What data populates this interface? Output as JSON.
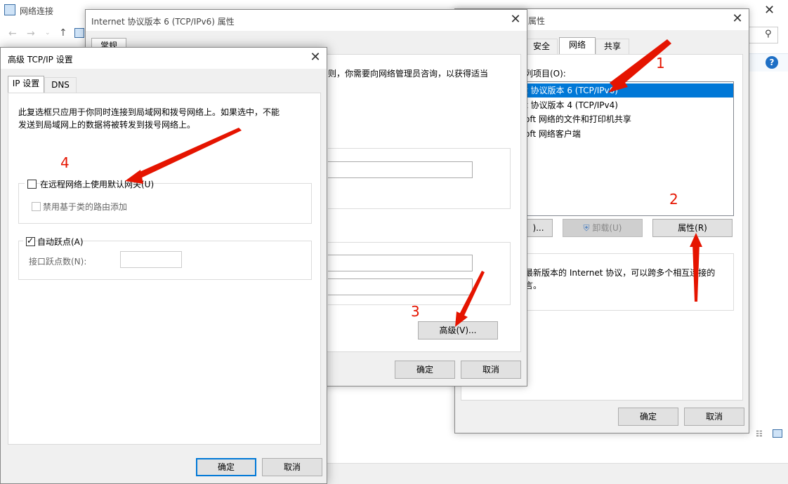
{
  "explorer": {
    "title": "网络连接",
    "taskbar_hint": "⬚"
  },
  "props_dialog": {
    "title": "属性",
    "tabs": [
      "安全",
      "网络",
      "共享"
    ],
    "items_label": "此连接使用下列项目(O):",
    "items_label_visible": "列项目(O):",
    "items": [
      "Internet 协议版本 6 (TCP/IPv6)",
      "Internet 协议版本 4 (TCP/IPv4)",
      "Microsoft 网络的文件和打印机共享",
      "Microsoft 网络客户端"
    ],
    "items_visible": [
      "t 协议版本 6 (TCP/IPv6)",
      "t 协议版本 4 (TCP/IPv4)",
      "oft 网络的文件和打印机共享",
      "oft 网络客户端"
    ],
    "install_btn": ")...",
    "uninstall_btn": "卸载(U)",
    "properties_btn": "属性(R)",
    "desc_line1": "最新版本的 Internet 协议，可以跨多个相互连接的",
    "desc_line2": "言。",
    "ok": "确定",
    "cancel": "取消"
  },
  "ipv6_dialog": {
    "title": "Internet 协议版本 6 (TCP/IPv6) 属性",
    "tab": "常规",
    "text": "则，你需要向网络管理员咨询，以获得适当",
    "advanced_btn": "高级(V)...",
    "ok": "确定",
    "cancel": "取消"
  },
  "adv_dialog": {
    "title": "高级 TCP/IP 设置",
    "tabs": [
      "IP 设置",
      "DNS"
    ],
    "desc_line1": "此复选框只应用于你同时连接到局域网和拨号网络上。如果选中，不能",
    "desc_line2": "发送到局域网上的数据将被转发到拨号网络上。",
    "use_default_gateway": "在远程网络上使用默认网关(U)",
    "disable_class_route": "禁用基于类的路由添加",
    "auto_metric": "自动跃点(A)",
    "metric_label": "接口跃点数(N):",
    "ok": "确定",
    "cancel": "取消"
  },
  "annotations": [
    "1",
    "2",
    "3",
    "4"
  ],
  "colors": {
    "accent": "#0078d7",
    "annotation": "#e51400"
  }
}
